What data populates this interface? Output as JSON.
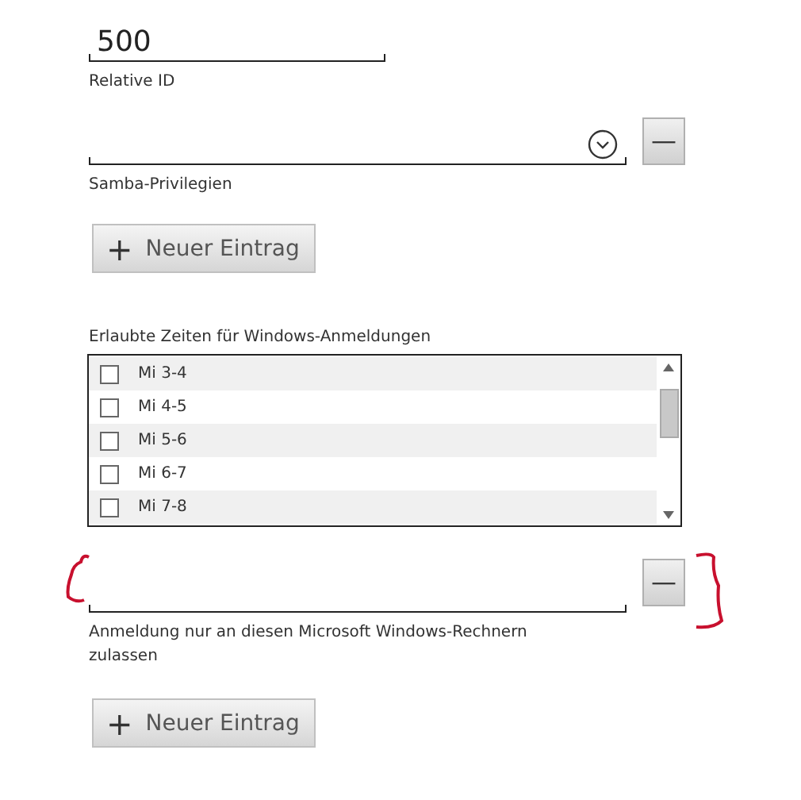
{
  "relative_id": {
    "value": "500",
    "label": "Relative ID"
  },
  "samba_privileges": {
    "label": "Samba-Privilegien",
    "remove_button": "—"
  },
  "add_button_1": {
    "icon": "+",
    "label": "Neuer Eintrag"
  },
  "logon_times": {
    "label": "Erlaubte Zeiten für Windows-Anmeldungen",
    "items": [
      {
        "label": "Mi 3-4",
        "checked": false
      },
      {
        "label": "Mi 4-5",
        "checked": false
      },
      {
        "label": "Mi 5-6",
        "checked": false
      },
      {
        "label": "Mi 6-7",
        "checked": false
      },
      {
        "label": "Mi 7-8",
        "checked": false
      }
    ]
  },
  "allowed_hosts": {
    "label": "Anmeldung nur an diesen Microsoft Windows-Rechnern zulassen",
    "remove_button": "—"
  },
  "add_button_2": {
    "icon": "+",
    "label": "Neuer Eintrag"
  }
}
